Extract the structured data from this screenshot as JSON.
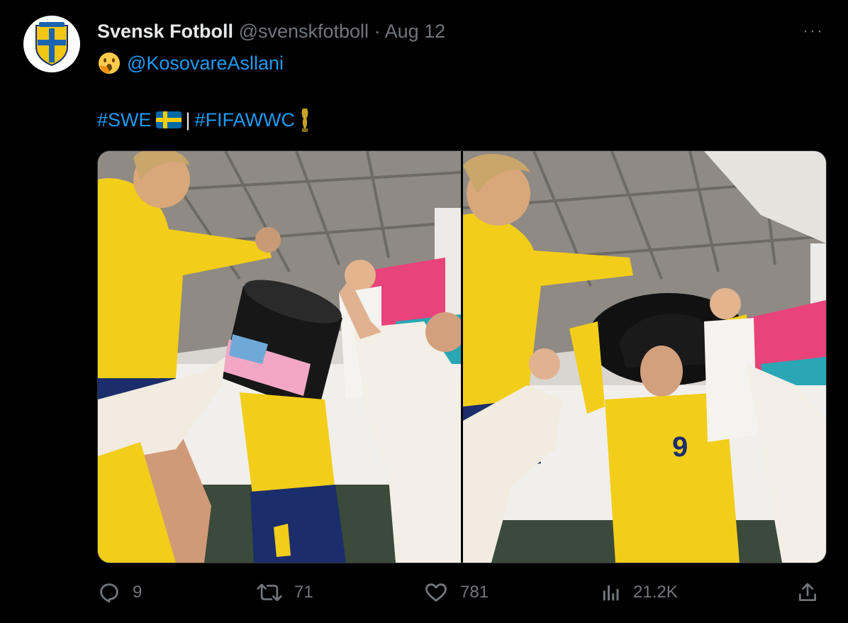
{
  "tweet": {
    "display_name": "Svensk Fotboll",
    "handle": "@svenskfotboll",
    "separator": "·",
    "date": "Aug 12",
    "more": "···",
    "mention": "@KosovareAsllani",
    "hashtag_swe": "#SWE",
    "divider": "|",
    "hashtag_fifa": "#FIFAWWC",
    "icons": {
      "emoji_1": "astonished-face-with-hand-icon",
      "flag": "sweden-flag-icon",
      "trophy": "trophy-icon"
    }
  },
  "media": {
    "photos": [
      {
        "description_icon": "photo-left"
      },
      {
        "description_icon": "photo-right"
      }
    ]
  },
  "actions": {
    "replies": "9",
    "retweets": "71",
    "likes": "781",
    "views": "21.2K"
  },
  "colors": {
    "background": "#000000",
    "link": "#1d9bf0",
    "muted": "#71767b",
    "jersey_yellow": "#f2cd1a",
    "jersey_blue": "#1b2d6b"
  }
}
